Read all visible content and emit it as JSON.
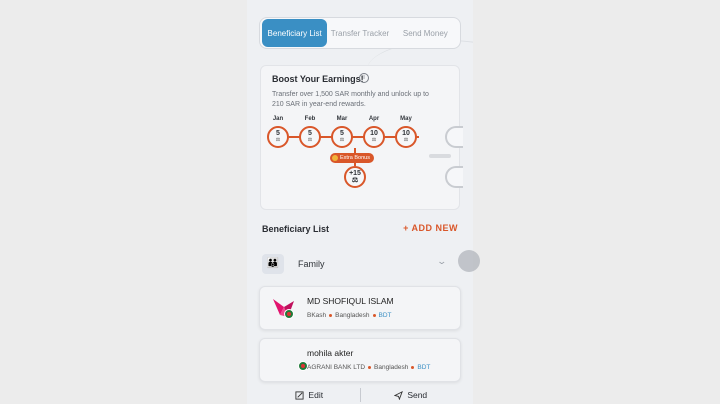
{
  "tabs": [
    {
      "label": "Beneficiary List",
      "active": true
    },
    {
      "label": "Transfer Tracker",
      "active": false
    },
    {
      "label": "Send Money",
      "active": false
    }
  ],
  "boost": {
    "title": "Boost Your Earnings!",
    "description": "Transfer over 1,500 SAR monthly and unlock up to 210 SAR in year-end rewards.",
    "months": [
      {
        "label": "Jan",
        "value": "5"
      },
      {
        "label": "Feb",
        "value": "5"
      },
      {
        "label": "Mar",
        "value": "5"
      },
      {
        "label": "Apr",
        "value": "10"
      },
      {
        "label": "May",
        "value": "10"
      }
    ],
    "bonus_label": "Extra Bonus",
    "bonus_value": "+15"
  },
  "beneficiaries": {
    "title": "Beneficiary List",
    "add_new": "+ ADD NEW",
    "group": "Family",
    "items": [
      {
        "name": "MD SHOFIQUL ISLAM",
        "provider": "BKash",
        "country": "Bangladesh",
        "currency": "BDT"
      },
      {
        "name": "mohila akter",
        "provider": "AGRANI BANK LTD",
        "country": "Bangladesh",
        "currency": "BDT"
      }
    ]
  },
  "actions": {
    "edit": "Edit",
    "send": "Send"
  },
  "colors": {
    "accent": "#d9572a",
    "primary": "#3a8fc4"
  }
}
